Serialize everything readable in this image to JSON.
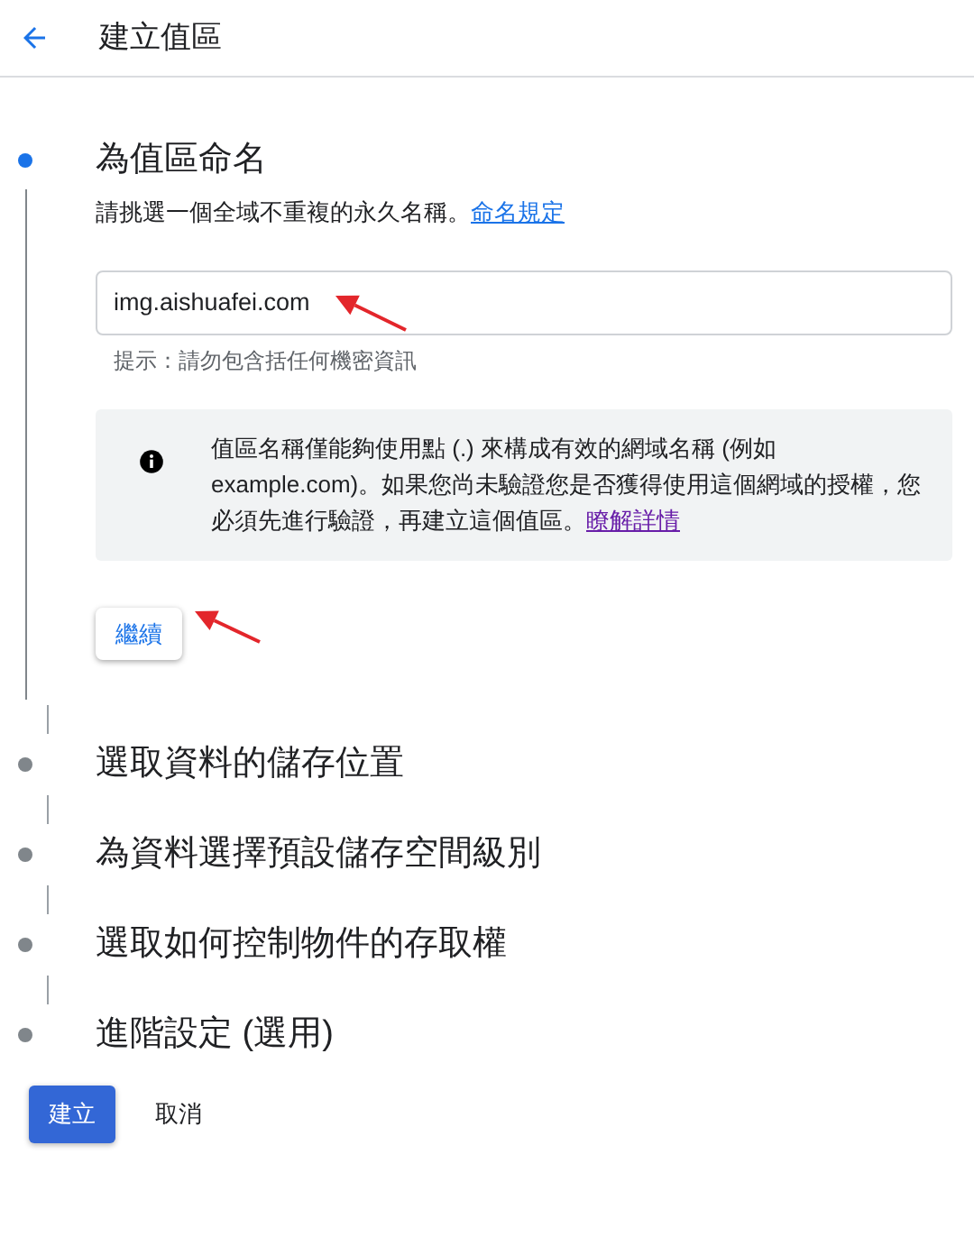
{
  "header": {
    "title": "建立值區"
  },
  "steps": [
    {
      "title": "為值區命名",
      "active": true,
      "content": {
        "description": "請挑選一個全域不重複的永久名稱。",
        "description_link": "命名規定",
        "field": {
          "value": "img.aishuafei.com"
        },
        "hint": "提示：請勿包含括任何機密資訊",
        "info": {
          "text": "值區名稱僅能夠使用點 (.) 來構成有效的網域名稱 (例如 example.com)。如果您尚未驗證您是否獲得使用這個網域的授權，您必須先進行驗證，再建立這個值區。",
          "link": "瞭解詳情"
        },
        "continue_button": "繼續"
      }
    },
    {
      "title": "選取資料的儲存位置",
      "active": false
    },
    {
      "title": "為資料選擇預設儲存空間級別",
      "active": false
    },
    {
      "title": "選取如何控制物件的存取權",
      "active": false
    },
    {
      "title": "進階設定 (選用)",
      "active": false
    }
  ],
  "actions": {
    "primary": "建立",
    "secondary": "取消"
  }
}
